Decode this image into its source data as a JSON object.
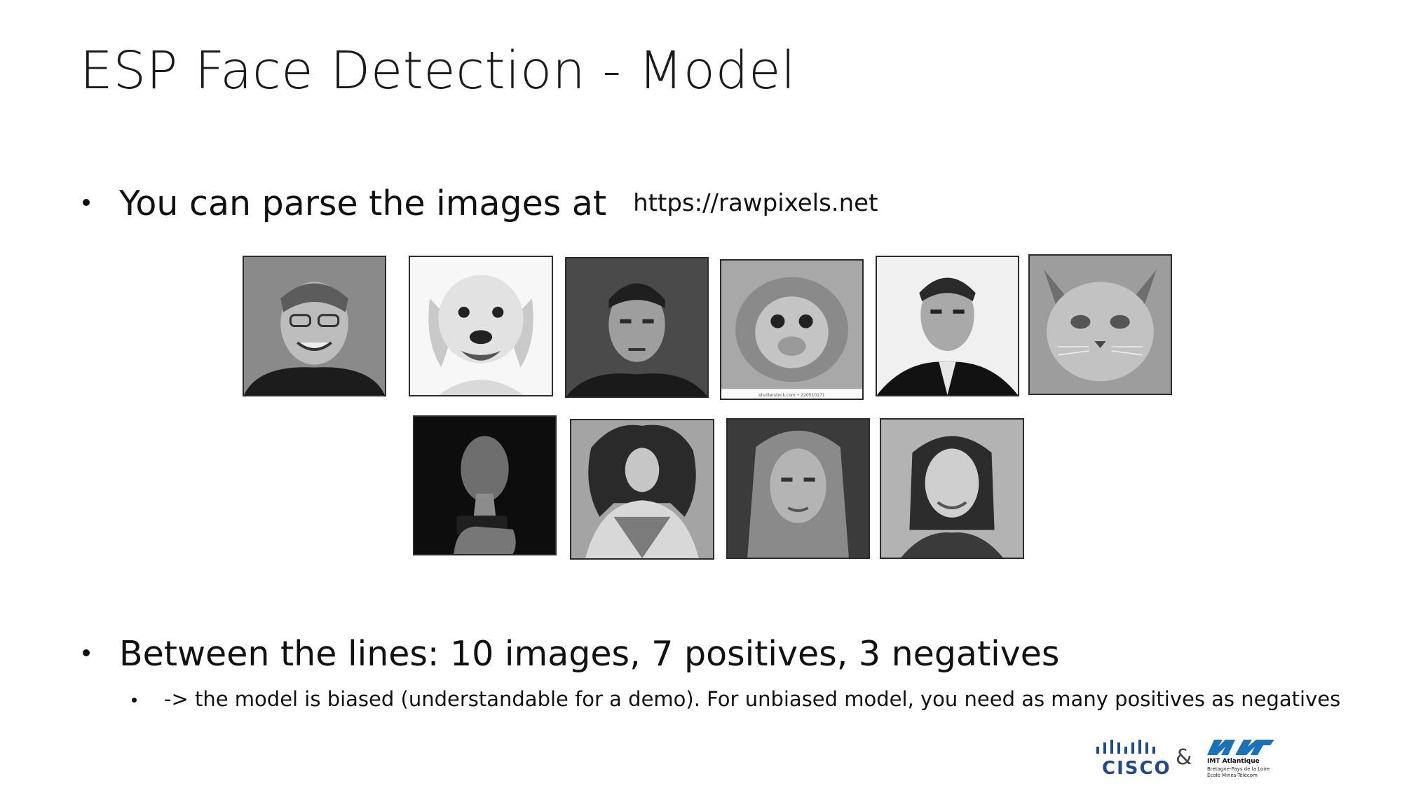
{
  "slide": {
    "title": "ESP Face Detection - Model",
    "bullet1": {
      "text": "You can parse the images at",
      "url": "https://rawpixels.net"
    },
    "bullet2": {
      "text": "Between the lines: 10 images, 7 positives, 3 negatives"
    },
    "bullet3": {
      "text": "-> the model is biased (understandable for a demo). For unbiased model, you need as many positives as negatives"
    },
    "watermark": "shutterstock.com • 220510171"
  },
  "images": [
    {
      "name": "man-glasses-smiling-photo"
    },
    {
      "name": "golden-retriever-photo"
    },
    {
      "name": "young-man-portrait-photo"
    },
    {
      "name": "monkey-face-photo"
    },
    {
      "name": "man-suit-portrait-photo"
    },
    {
      "name": "cat-face-photo"
    },
    {
      "name": "man-phone-light-photo"
    },
    {
      "name": "baroque-king-painting"
    },
    {
      "name": "woman-portrait-photo"
    },
    {
      "name": "woman-smiling-photo"
    }
  ],
  "logos": {
    "cisco": "CISCO",
    "amp": "&",
    "imt_name": "IMT Atlantique",
    "imt_sub1": "Bretagne-Pays de la Loire",
    "imt_sub2": "École Mines-Télécom"
  }
}
